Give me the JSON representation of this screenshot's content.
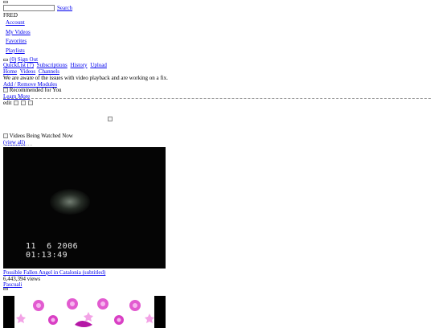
{
  "header": {
    "search_placeholder": "",
    "search_button_label": "Search",
    "username": "FRED"
  },
  "user_menu": {
    "items": [
      {
        "label": "Account"
      },
      {
        "label": "My Videos"
      },
      {
        "label": "Favorites"
      },
      {
        "label": "Playlists"
      }
    ],
    "inbox_count_label": "(0)",
    "sign_out_label": "Sign Out"
  },
  "quick_links": {
    "quicklist_label": "QuickList",
    "quicklist_count": "(7)",
    "subscriptions_label": "Subscriptions",
    "history_label": "History",
    "upload_label": "Upload"
  },
  "main_nav": {
    "items": [
      {
        "label": "Home"
      },
      {
        "label": "Videos"
      },
      {
        "label": "Channels"
      }
    ]
  },
  "notice_text": "We are aware of the issues with video playback and are working on a fix.",
  "add_remove_modules_label": "Add / Remove Modules",
  "recommended": {
    "title": "Recommended for You",
    "learn_more_label": "Learn More",
    "edit_label": "edit"
  },
  "being_watched": {
    "title": "Videos Being Watched Now",
    "view_all_label": "(view all)",
    "videos": [
      {
        "title": "Possible Fallen Angel in Catalonia (subtitled)",
        "views": "6,443,394 views",
        "user": "Pascuali",
        "thumbnail_date": "11  6 2006",
        "thumbnail_time": "01:13:49"
      }
    ]
  },
  "colors": {
    "link": "#0000ee",
    "thumb_bg": "#050505",
    "flower_pink": "#d93fc4",
    "flower_light": "#f6b6ee"
  }
}
